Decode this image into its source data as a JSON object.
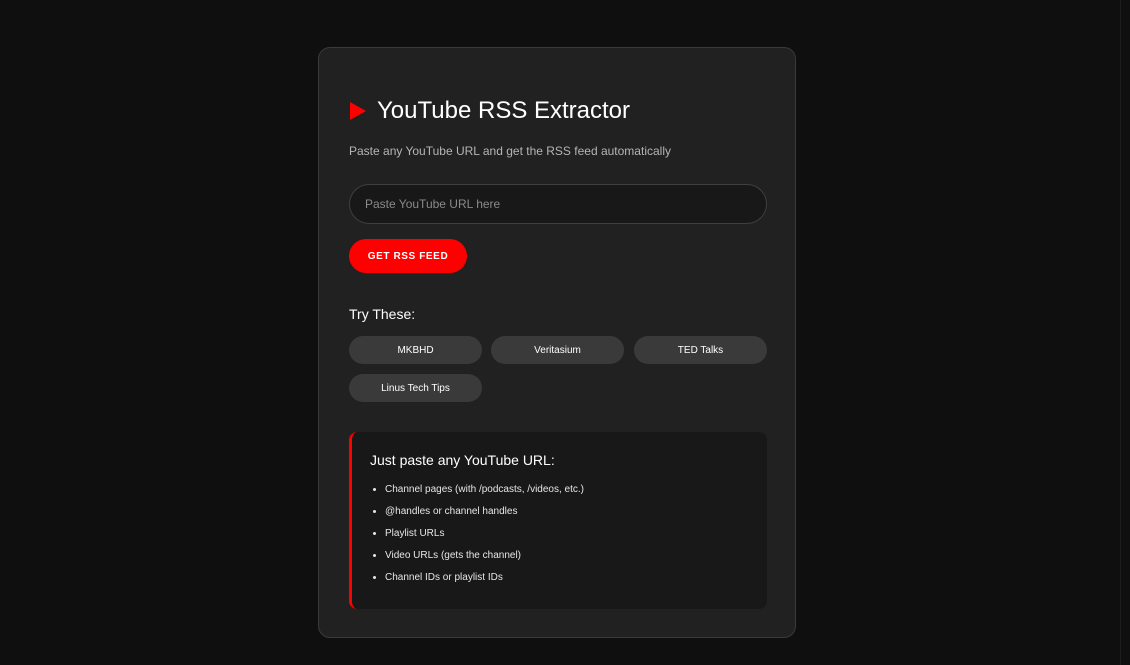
{
  "app": {
    "title": "YouTube RSS Extractor",
    "subtitle": "Paste any YouTube URL and get the RSS feed automatically",
    "icon": "play-icon",
    "accent_color": "#ff0000"
  },
  "form": {
    "url_input": {
      "value": "",
      "placeholder": "Paste YouTube URL here"
    },
    "submit_label": "GET RSS FEED"
  },
  "examples": {
    "heading": "Try These:",
    "items": [
      {
        "label": "MKBHD"
      },
      {
        "label": "Veritasium"
      },
      {
        "label": "TED Talks"
      },
      {
        "label": "Linus Tech Tips"
      }
    ]
  },
  "info": {
    "title": "Just paste any YouTube URL:",
    "items": [
      "Channel pages (with /podcasts, /videos, etc.)",
      "@handles or channel handles",
      "Playlist URLs",
      "Video URLs (gets the channel)",
      "Channel IDs or playlist IDs"
    ]
  }
}
